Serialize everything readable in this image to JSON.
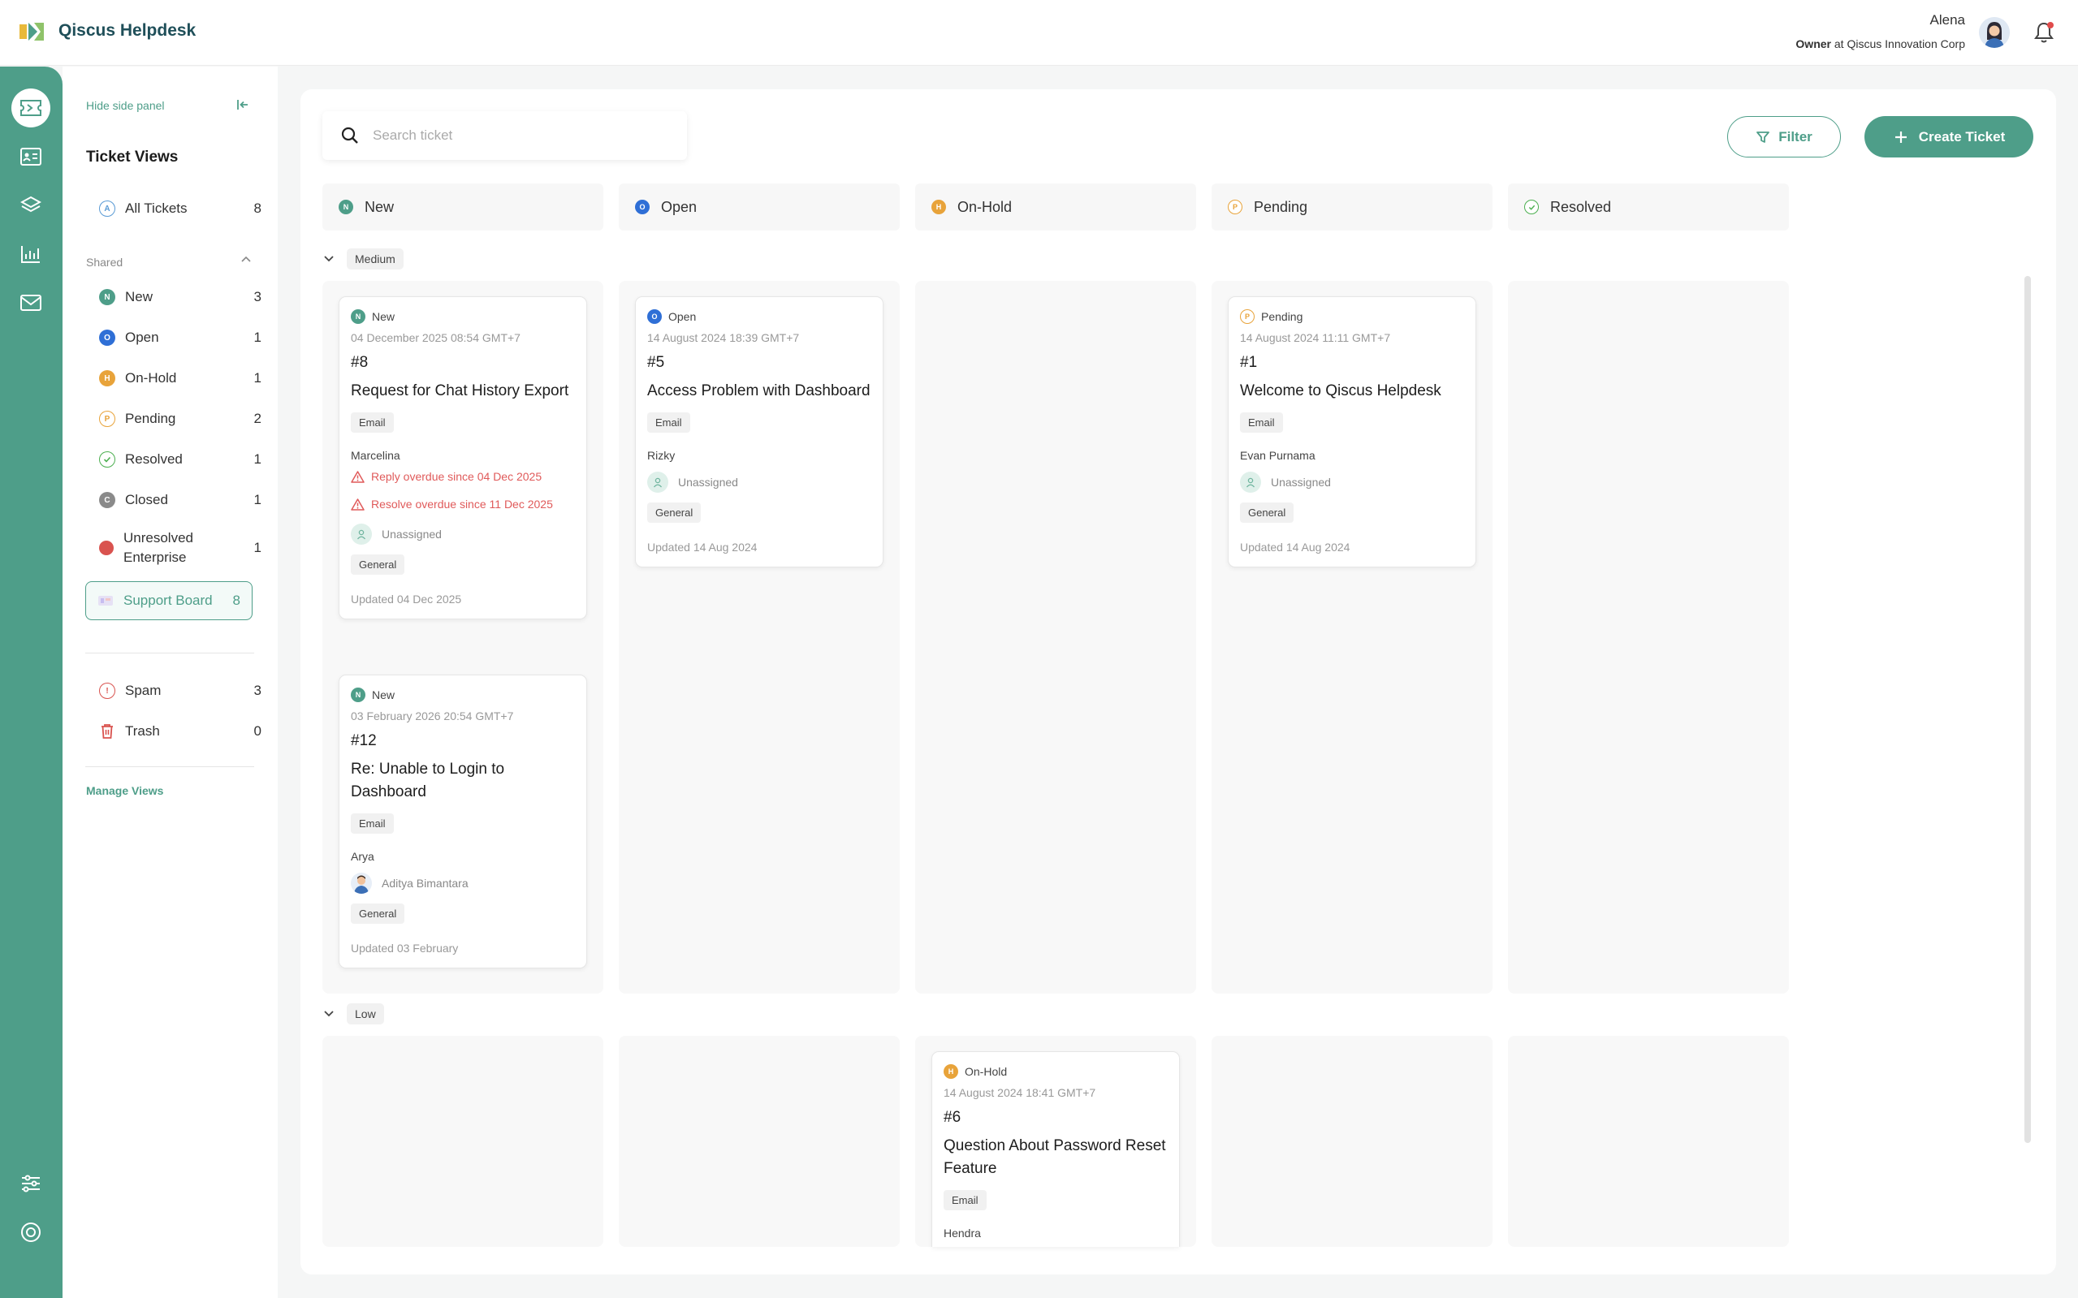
{
  "header": {
    "brand": "Qiscus Helpdesk",
    "user_name": "Alena",
    "user_role": "Owner",
    "user_role_at": " at ",
    "user_company": "Qiscus Innovation Corp"
  },
  "side_panel": {
    "hide_label": "Hide side panel",
    "views_title": "Ticket Views",
    "all_tickets": {
      "label": "All Tickets",
      "count": "8"
    },
    "shared_label": "Shared",
    "shared_items": [
      {
        "label": "New",
        "count": "3",
        "icon": "N",
        "color": "#4e9e89"
      },
      {
        "label": "Open",
        "count": "1",
        "icon": "O",
        "color": "#2f6fd6"
      },
      {
        "label": "On-Hold",
        "count": "1",
        "icon": "H",
        "color": "#e8a33a"
      },
      {
        "label": "Pending",
        "count": "2",
        "icon": "P",
        "color": "#e8a33a"
      },
      {
        "label": "Resolved",
        "count": "1",
        "icon": "check",
        "color": "#4caf50"
      },
      {
        "label": "Closed",
        "count": "1",
        "icon": "C",
        "color": "#8a8a8a"
      },
      {
        "label": "Unresolved Enterprise",
        "count": "1",
        "icon": "dot",
        "color": "#d9534f"
      }
    ],
    "board": {
      "label": "Support Board",
      "count": "8"
    },
    "spam": {
      "label": "Spam",
      "count": "3"
    },
    "trash": {
      "label": "Trash",
      "count": "0"
    },
    "manage_views": "Manage Views"
  },
  "toolbar": {
    "search_placeholder": "Search ticket",
    "filter_label": "Filter",
    "create_label": "Create Ticket"
  },
  "columns": [
    {
      "label": "New",
      "icon": "N",
      "color": "#4e9e89"
    },
    {
      "label": "Open",
      "icon": "O",
      "color": "#2f6fd6"
    },
    {
      "label": "On-Hold",
      "icon": "H",
      "color": "#e8a33a"
    },
    {
      "label": "Pending",
      "icon": "P",
      "color": "#e8a33a"
    },
    {
      "label": "Resolved",
      "icon": "check",
      "color": "#4caf50"
    }
  ],
  "groups": {
    "medium": "Medium",
    "low": "Low"
  },
  "tickets": {
    "t8": {
      "status": "New",
      "date": "04 December 2025 08:54 GMT+7",
      "number": "#8",
      "title": "Request for Chat History Export",
      "channel": "Email",
      "customer": "Marcelina",
      "warn1": "Reply overdue since 04 Dec 2025",
      "warn2": "Resolve overdue since 11 Dec 2025",
      "agent": "Unassigned",
      "group": "General",
      "updated": "Updated 04 Dec 2025"
    },
    "t12": {
      "status": "New",
      "date": "03 February 2026 20:54 GMT+7",
      "number": "#12",
      "title": "Re: Unable to Login to Dashboard",
      "channel": "Email",
      "customer": "Arya",
      "agent": "Aditya Bimantara",
      "group": "General",
      "updated": "Updated 03 February"
    },
    "t5": {
      "status": "Open",
      "date": "14 August 2024 18:39 GMT+7",
      "number": "#5",
      "title": "Access Problem with Dashboard",
      "channel": "Email",
      "customer": "Rizky",
      "agent": "Unassigned",
      "group": "General",
      "updated": "Updated 14 Aug 2024"
    },
    "t1": {
      "status": "Pending",
      "date": "14 August 2024 11:11 GMT+7",
      "number": "#1",
      "title": "Welcome to Qiscus Helpdesk",
      "channel": "Email",
      "customer": "Evan Purnama",
      "agent": "Unassigned",
      "group": "General",
      "updated": "Updated 14 Aug 2024"
    },
    "t6": {
      "status": "On-Hold",
      "date": "14 August 2024 18:41 GMT+7",
      "number": "#6",
      "title": "Question About Password Reset Feature",
      "channel": "Email",
      "customer": "Hendra"
    }
  }
}
